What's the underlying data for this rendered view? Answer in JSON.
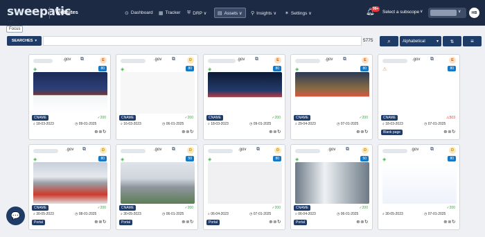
{
  "header": {
    "logo": "sweepatic",
    "logo_sub": "· · ·",
    "section": "Websites",
    "nav": [
      {
        "label": "Dashboard",
        "icon": "⊙",
        "name": "nav-dashboard"
      },
      {
        "label": "Tracker",
        "icon": "▦",
        "name": "nav-tracker"
      },
      {
        "label": "DRP ∨",
        "icon": "⛨",
        "name": "nav-drp"
      },
      {
        "label": "Assets ∨",
        "icon": "▤",
        "name": "nav-assets"
      },
      {
        "label": "Insights ∨",
        "icon": "⚲",
        "name": "nav-insights"
      },
      {
        "label": "Settings ∨",
        "icon": "✶",
        "name": "nav-settings"
      }
    ],
    "notifications_badge": "99+",
    "subscope_label": "Select a subscope",
    "avatar_initials": "HB"
  },
  "toolbar": {
    "focus_label": "Focus",
    "searches_label": "SEARCHES",
    "searches_icon": "▾",
    "count": "5775",
    "search_icon": "⌕",
    "sort_label": "Alphabetical",
    "sort_icon": "▾",
    "sort_dir_icon": "⇅",
    "menu_icon": "≡"
  },
  "cards": [
    {
      "domain": ".gov",
      "grade": "E",
      "score": "80",
      "status": "ok",
      "tag": "CNAME",
      "http": "✓200",
      "http_ok": true,
      "date1": "18-03-2023",
      "date2": "09-01-2025"
    },
    {
      "domain": ".gov",
      "grade": "D",
      "score": "80",
      "status": "ok",
      "tag": "CNAME",
      "http": "✓200",
      "http_ok": true,
      "date1": "16-03-2023",
      "date2": "06-01-2025"
    },
    {
      "domain": ".gov",
      "grade": "E",
      "score": "80",
      "status": "ok",
      "tag": "CNAME",
      "http": "✓200",
      "http_ok": true,
      "date1": "18-03-2023",
      "date2": "09-01-2025"
    },
    {
      "domain": ".gov",
      "grade": "E",
      "score": "80",
      "status": "ok",
      "tag": "CNAME",
      "http": "✓200",
      "http_ok": true,
      "date1": "29-04-2023",
      "date2": "07-01-2025"
    },
    {
      "domain": ".gov",
      "grade": "E",
      "score": "80",
      "status": "warn",
      "tag": "CNAME",
      "http": "⚠503",
      "http_ok": false,
      "date1": "18-03-2023",
      "date2": "07-01-2025",
      "bottom_tag": "Blank page"
    },
    {
      "domain": ".gov",
      "grade": "D",
      "score": "80",
      "status": "ok",
      "tag": "CNAME",
      "http": "✓200",
      "http_ok": true,
      "date1": "30-05-2023",
      "date2": "08-01-2025",
      "bottom_tag": "Portal"
    },
    {
      "domain": ".gov",
      "grade": "D",
      "score": "50",
      "status": "ok",
      "tag": "CNAME",
      "http": "✓200",
      "http_ok": true,
      "date1": "30-05-2023",
      "date2": "06-01-2025",
      "bottom_tag": "Portal"
    },
    {
      "domain": ".gov",
      "grade": "D",
      "score": "80",
      "status": "ok",
      "tag": "",
      "http": "✓200",
      "http_ok": true,
      "date1": "06-04-2023",
      "date2": "07-01-2025",
      "bottom_tag": "Portal"
    },
    {
      "domain": ".gov",
      "grade": "D",
      "score": "50",
      "status": "ok",
      "tag": "CNAME",
      "http": "✓200",
      "http_ok": true,
      "date1": "06-04-2023",
      "date2": "06-01-2025",
      "bottom_tag": "Portal"
    },
    {
      "domain": ".gov",
      "grade": "D",
      "score": "80",
      "status": "ok",
      "tag": "",
      "http": "✓200",
      "http_ok": true,
      "date1": "30-05-2023",
      "date2": "07-01-2025"
    }
  ],
  "chat_icon": "💬"
}
